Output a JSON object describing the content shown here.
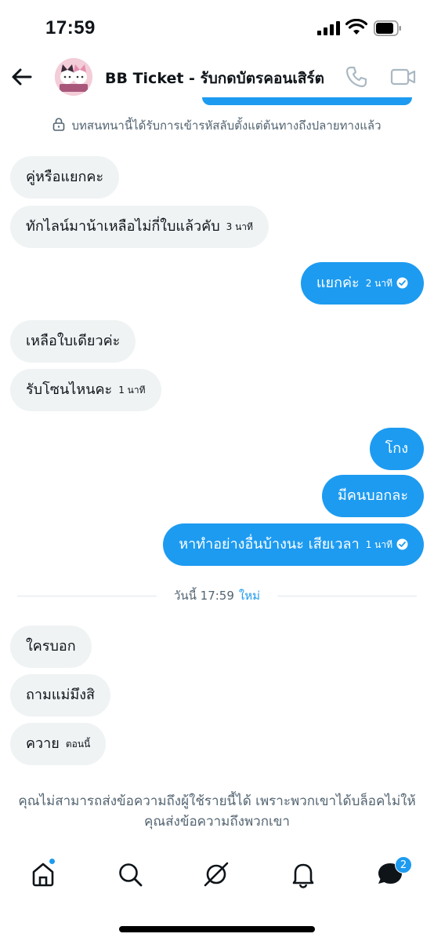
{
  "status_bar": {
    "time": "17:59"
  },
  "header": {
    "title": "BB Ticket - รับกดบัตรคอนเสิร์ต"
  },
  "encryption_notice": "บทสนทนานี้ได้รับการเข้ารหัสลับตั้งแต่ต้นทางถึงปลายทางแล้ว",
  "messages": [
    {
      "text": "คู่หรือแยกคะ",
      "time": ""
    },
    {
      "text": "ทักไลน์มาน้าเหลือไม่กี่ใบแล้วคับ",
      "time": "3 นาที"
    },
    {
      "text": "แยกค่ะ",
      "time": "2 นาที"
    },
    {
      "text": "เหลือใบเดียวค่ะ",
      "time": ""
    },
    {
      "text": "รับโซนไหนคะ",
      "time": "1 นาที"
    },
    {
      "text": "โกง",
      "time": ""
    },
    {
      "text": "มีคนบอกละ",
      "time": ""
    },
    {
      "text": "หาทำอย่างอื่นบ้างนะ เสียเวลา",
      "time": "1 นาที"
    },
    {
      "text": "ใครบอก",
      "time": ""
    },
    {
      "text": "ถามแม่มึงสิ",
      "time": ""
    },
    {
      "text": "ควาย",
      "time": "ตอนนี้"
    }
  ],
  "divider": {
    "label": "วันนี้ 17:59",
    "new_label": "ใหม่"
  },
  "blocked_notice": "คุณไม่สามารถส่งข้อความถึงผู้ใช้รายนี้ได้ เพราะพวกเขาได้บล็อคไม่ให้คุณส่งข้อความถึงพวกเขา",
  "bottom_nav": {
    "items": [
      "home-icon",
      "search-icon",
      "grok-icon",
      "notifications-icon",
      "messages-icon"
    ],
    "messages_badge": "2"
  },
  "colors": {
    "accent": "#1d9bf0",
    "incoming_bubble": "#eff3f4",
    "muted_text": "#536471"
  }
}
